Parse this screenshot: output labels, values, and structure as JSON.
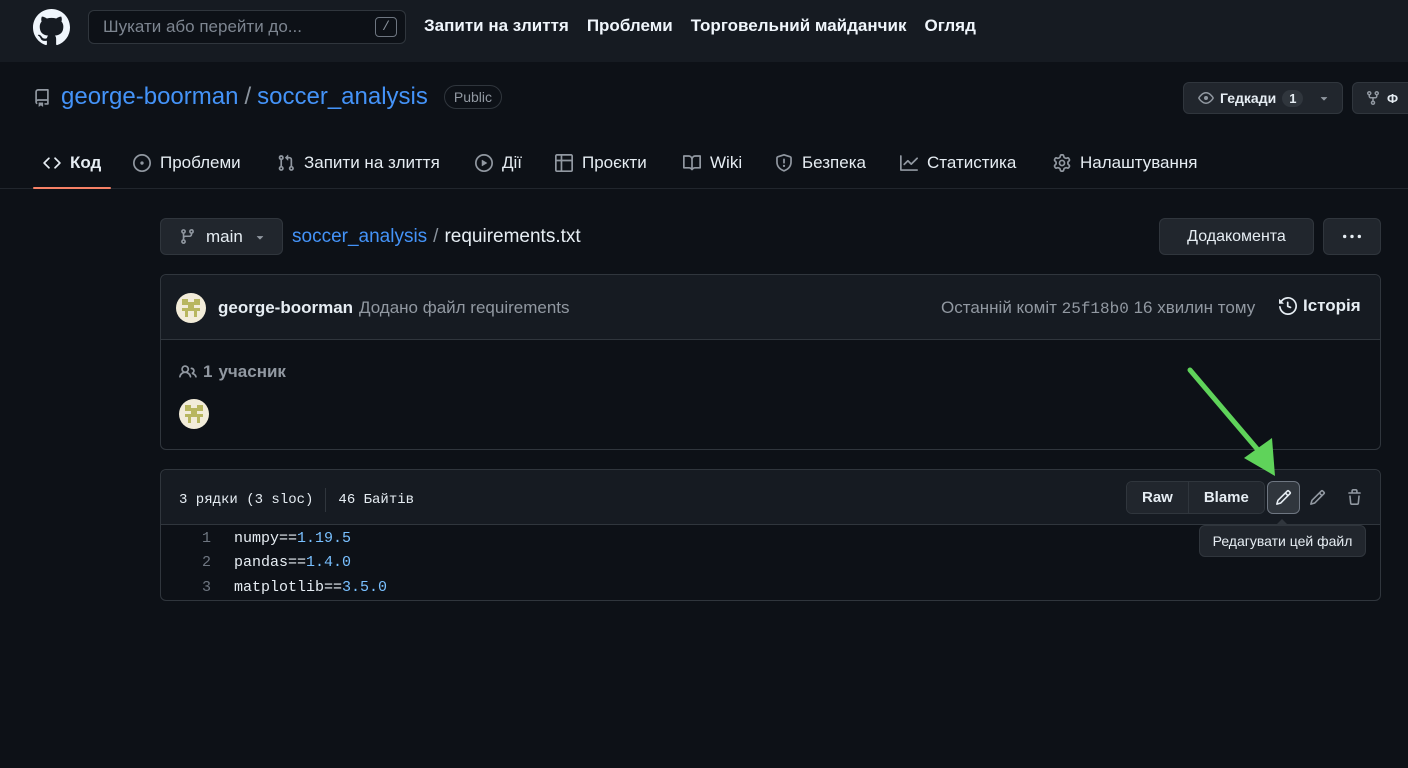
{
  "header": {
    "search_placeholder": "Шукати або перейти до...",
    "search_shortcut": "/",
    "nav": [
      "Запити на злиття",
      "Проблеми",
      "Торговельний майданчик",
      "Огляд"
    ]
  },
  "repo": {
    "owner": "george-boorman",
    "separator": "/",
    "name": "soccer_analysis",
    "visibility": "Public",
    "watch_label": "Гедкади",
    "watch_count": "1",
    "fork_label": "Ф"
  },
  "tabs": [
    {
      "label": "Код",
      "icon": "code-icon",
      "active": true
    },
    {
      "label": "Проблеми",
      "icon": "issue-icon"
    },
    {
      "label": "Запити на злиття",
      "icon": "pull-request-icon"
    },
    {
      "label": "Дії",
      "icon": "play-icon"
    },
    {
      "label": "Проєкти",
      "icon": "table-icon"
    },
    {
      "label": "Wiki",
      "icon": "book-icon"
    },
    {
      "label": "Безпека",
      "icon": "shield-icon"
    },
    {
      "label": "Статистика",
      "icon": "graph-icon"
    },
    {
      "label": "Налаштування",
      "icon": "gear-icon"
    }
  ],
  "file_nav": {
    "branch": "main",
    "path_repo": "soccer_analysis",
    "path_sep": "/",
    "file_name": "requirements.txt",
    "goto_label": "Додакомента"
  },
  "commit": {
    "author": "george-boorman",
    "message": "Додано файл requirements",
    "last_commit_label": "Останній коміт",
    "sha": "25f18b0",
    "time_ago": "16 хвилин тому",
    "history_label": "Історія",
    "contributors_count": "1",
    "contributors_label": "учасник"
  },
  "file": {
    "lines_info": "3 рядки (3 sloc)",
    "size": "46 Байтів",
    "raw_label": "Raw",
    "blame_label": "Blame",
    "edit_tooltip": "Редагувати цей файл",
    "code_lines": [
      {
        "n": "1",
        "pkg": "numpy==",
        "ver": "1.19.5"
      },
      {
        "n": "2",
        "pkg": "pandas==",
        "ver": "1.4.0"
      },
      {
        "n": "3",
        "pkg": "matplotlib==",
        "ver": "3.5.0"
      }
    ]
  },
  "colors": {
    "background": "#0d1117",
    "link": "#4493f8",
    "active_tab_underline": "#f78166",
    "annotation_arrow": "#5fd35a"
  }
}
